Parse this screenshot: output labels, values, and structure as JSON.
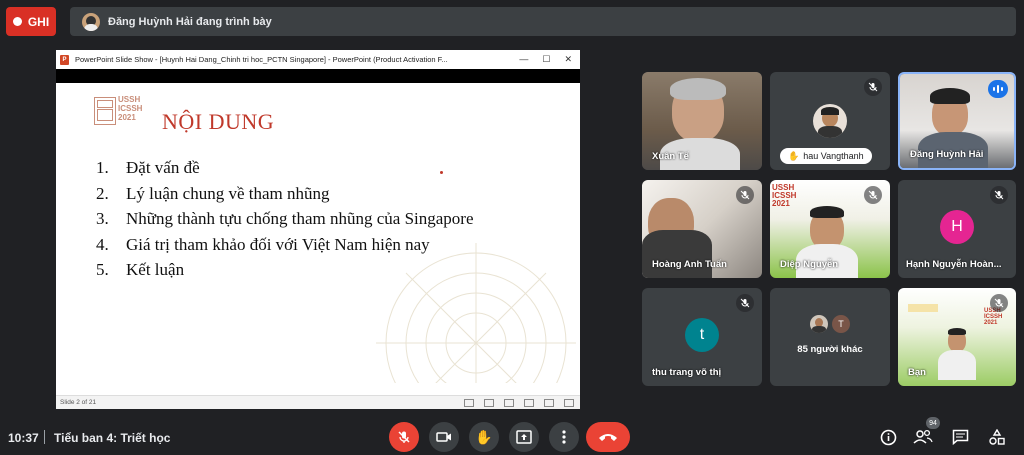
{
  "recording": {
    "label": "GHI"
  },
  "presenter_banner": {
    "text": "Đăng Huỳnh Hải đang trình bày"
  },
  "slide_window": {
    "title": "PowerPoint Slide Show - [Huynh Hai Dang_Chinh tri hoc_PCTN Singapore] - PowerPoint (Product Activation F...",
    "status": "Slide 2 of 21",
    "logo_lines": [
      "USSH",
      "ICSSH",
      "2021"
    ],
    "heading": "NỘI DUNG",
    "items": [
      {
        "num": "1.",
        "text": "Đặt vấn đề"
      },
      {
        "num": "2.",
        "text": "Lý luận chung về tham nhũng"
      },
      {
        "num": "3.",
        "text": "Những thành tựu chống tham nhũng của Singapore"
      },
      {
        "num": "4.",
        "text": "Giá trị tham khảo đối với Việt Nam hiện nay"
      },
      {
        "num": "5.",
        "text": "Kết luận"
      }
    ]
  },
  "participants": [
    {
      "name": "Xuân Tế",
      "muted": false
    },
    {
      "name": "hau Vangthanh",
      "muted": true,
      "hand_raised": true
    },
    {
      "name": "Đăng Huỳnh Hải",
      "speaking": true
    },
    {
      "name": "Hoàng Anh Tuấn",
      "muted": true
    },
    {
      "name": "Diệp Nguyễn",
      "muted": true
    },
    {
      "name": "Hạnh Nguyễn Hoàn...",
      "muted": true,
      "initial": "H",
      "color": "#e52592"
    },
    {
      "name": "thu trang võ thị",
      "muted": true,
      "initial": "t",
      "color": "#00838f"
    },
    {
      "name": "85 người khác",
      "initial_small": "T"
    },
    {
      "name": "Bạn",
      "muted": true
    }
  ],
  "bottom_bar": {
    "time": "10:37",
    "meeting_title": "Tiểu ban 4: Triết học",
    "people_count": "94"
  },
  "colors": {
    "accent_red": "#ea4335",
    "speaking_blue": "#1a73e8",
    "slide_title_red": "#c0392b"
  }
}
